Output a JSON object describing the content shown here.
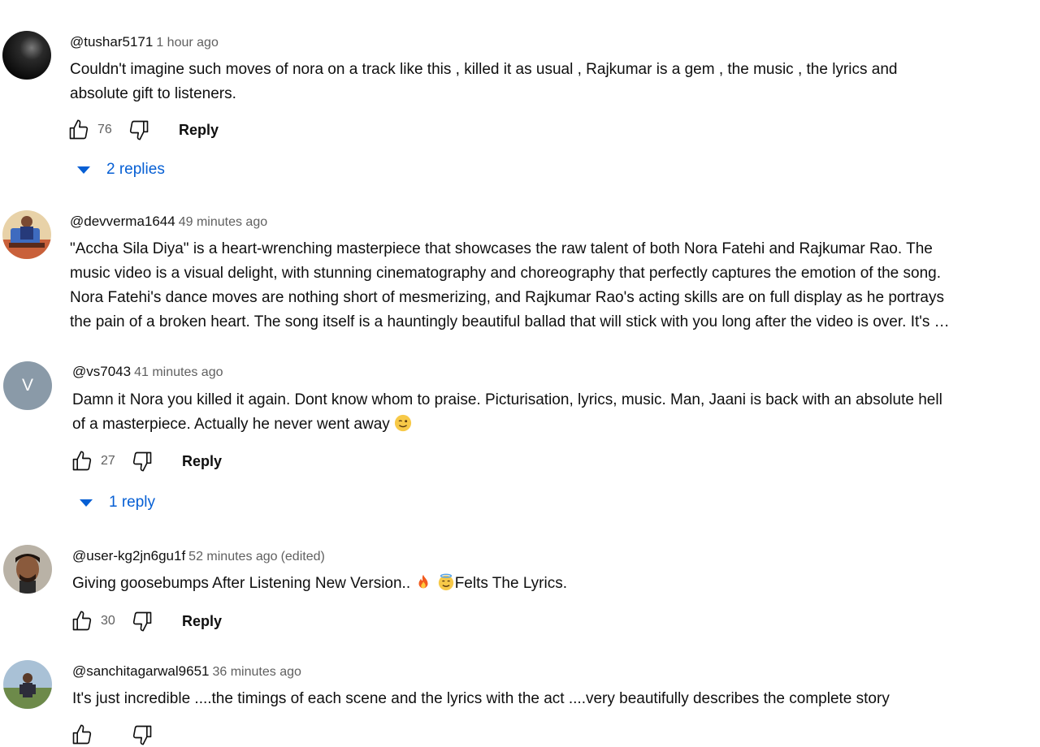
{
  "comments": [
    {
      "author": "@tushar5171",
      "time": "1 hour ago",
      "edited": "",
      "lines": [
        "Couldn't imagine such moves of nora on a track like this , killed it as usual , Rajkumar is a gem , the music , the lyrics and",
        "absolute gift to listeners."
      ],
      "likes": "76",
      "reply_label": "Reply",
      "replies_label": "2 replies",
      "avatar_icon": "dark-sphere-avatar-icon"
    },
    {
      "author": "@devverma1644",
      "time": "49 minutes ago",
      "edited": "",
      "lines": [
        "\"Accha Sila Diya\" is a heart-wrenching masterpiece that showcases the raw talent of both Nora Fatehi and Rajkumar Rao. The",
        "music video is a visual delight, with stunning cinematography and choreography that perfectly captures the emotion of the song.",
        "Nora Fatehi's dance moves are nothing short of mesmerizing, and Rajkumar Rao's acting skills are on full display as he portrays",
        "the pain of a broken heart. The song itself is a hauntingly beautiful ballad that will stick with you long after the video is over. It's …"
      ],
      "avatar_icon": "illustrated-person-avatar-icon"
    },
    {
      "author": "@vs7043",
      "time": "41 minutes ago",
      "edited": "",
      "avatar_letter": "V",
      "lines": [
        "Damn it Nora you killed it again. Dont know whom to praise. Picturisation, lyrics, music. Man, Jaani is back with an absolute hell",
        "of a masterpiece. Actually he never went away"
      ],
      "likes": "27",
      "reply_label": "Reply",
      "replies_label": "1 reply"
    },
    {
      "author": "@user-kg2jn6gu1f",
      "time": "52 minutes ago",
      "edited": "(edited)",
      "lines_a": "Giving goosebumps After Listening  New Version..",
      "lines_b": "Felts The Lyrics.",
      "likes": "30",
      "reply_label": "Reply",
      "avatar_icon": "man-photo-avatar-icon"
    },
    {
      "author": "@sanchitagarwal9651",
      "time": "36 minutes ago",
      "edited": "",
      "lines": [
        "It's just incredible ....the timings of each scene and the lyrics with the act ....very beautifully describes the complete story"
      ],
      "avatar_icon": "outdoor-person-avatar-icon"
    }
  ],
  "colors": {
    "link_blue": "#065fd4",
    "secondary_text": "#606060",
    "primary_text": "#0f0f0f",
    "letter_avatar_bg": "#8a9aa8"
  }
}
